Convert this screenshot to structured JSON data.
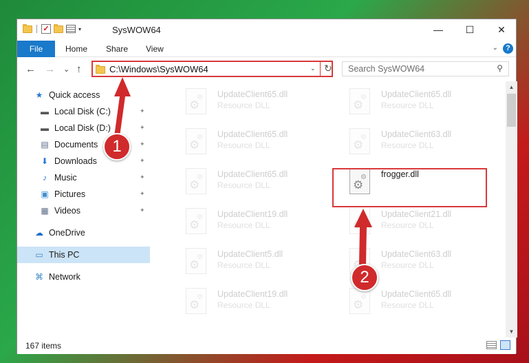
{
  "window": {
    "title": "SysWOW64",
    "controls": {
      "minimize": "—",
      "maximize": "☐",
      "close": "✕"
    }
  },
  "quick_access_toolbar": {
    "dropdown_glyph": "▾"
  },
  "ribbon": {
    "tabs": [
      "File",
      "Home",
      "Share",
      "View"
    ],
    "collapse_glyph": "⌄",
    "help_glyph": "?"
  },
  "navigation": {
    "back_glyph": "←",
    "forward_glyph": "→",
    "recent_glyph": "⌄",
    "up_glyph": "↑",
    "address": "C:\\Windows\\SysWOW64",
    "address_dropdown_glyph": "⌄",
    "refresh_glyph": "↻",
    "search_placeholder": "Search SysWOW64",
    "search_glyph": "⚲"
  },
  "sidebar": {
    "items": [
      {
        "label": "Quick access",
        "icon": "star-icon",
        "glyph": "★",
        "color": "#2b79d6",
        "pinned": false
      },
      {
        "label": "Local Disk (C:)",
        "icon": "drive-icon",
        "glyph": "▬",
        "color": "#555555",
        "pinned": true
      },
      {
        "label": "Local Disk (D:)",
        "icon": "drive-icon",
        "glyph": "▬",
        "color": "#555555",
        "pinned": true
      },
      {
        "label": "Documents",
        "icon": "documents-icon",
        "glyph": "▤",
        "color": "#5a6a86",
        "pinned": true
      },
      {
        "label": "Downloads",
        "icon": "download-icon",
        "glyph": "⬇",
        "color": "#2b79d6",
        "pinned": true
      },
      {
        "label": "Music",
        "icon": "music-icon",
        "glyph": "♪",
        "color": "#2b79d6",
        "pinned": true
      },
      {
        "label": "Pictures",
        "icon": "pictures-icon",
        "glyph": "▣",
        "color": "#3f8fd0",
        "pinned": true
      },
      {
        "label": "Videos",
        "icon": "videos-icon",
        "glyph": "▦",
        "color": "#5a6a86",
        "pinned": true
      },
      {
        "label": "OneDrive",
        "icon": "cloud-icon",
        "glyph": "☁",
        "color": "#1e6fc9",
        "pinned": false
      },
      {
        "label": "This PC",
        "icon": "computer-icon",
        "glyph": "▭",
        "color": "#3a86c8",
        "pinned": false,
        "selected": true
      },
      {
        "label": "Network",
        "icon": "network-icon",
        "glyph": "⌘",
        "color": "#3a86c8",
        "pinned": false
      }
    ],
    "pin_glyph": "📌"
  },
  "files": [
    {
      "name": "UpdateClient65.dll",
      "type": "Resource DLL",
      "faded": true
    },
    {
      "name": "UpdateClient65.dll",
      "type": "Resource DLL",
      "faded": true
    },
    {
      "name": "UpdateClient65.dll",
      "type": "Resource DLL",
      "faded": true
    },
    {
      "name": "UpdateClient63.dll",
      "type": "Resource DLL",
      "faded": true
    },
    {
      "name": "UpdateClient65.dll",
      "type": "Resource DLL",
      "faded": true
    },
    {
      "name": "frogger.dll",
      "type": "",
      "faded": false
    },
    {
      "name": "UpdateClient19.dll",
      "type": "Resource DLL",
      "faded": true
    },
    {
      "name": "UpdateClient21.dll",
      "type": "Resource DLL",
      "faded": true
    },
    {
      "name": "UpdateClient5.dll",
      "type": "Resource DLL",
      "faded": true
    },
    {
      "name": "UpdateClient63.dll",
      "type": "Resource DLL",
      "faded": true
    },
    {
      "name": "UpdateClient19.dll",
      "type": "Resource DLL",
      "faded": true
    },
    {
      "name": "UpdateClient65.dll",
      "type": "Resource DLL",
      "faded": true
    }
  ],
  "status": {
    "item_count": "167 items"
  },
  "scrollbar": {
    "up_glyph": "▲",
    "down_glyph": "▼"
  },
  "callouts": {
    "step1": "1",
    "step2": "2",
    "color": "#d02a2c"
  },
  "colors": {
    "accent": "#1979ca",
    "highlight": "#d9383a",
    "selection": "#cce4f7"
  }
}
